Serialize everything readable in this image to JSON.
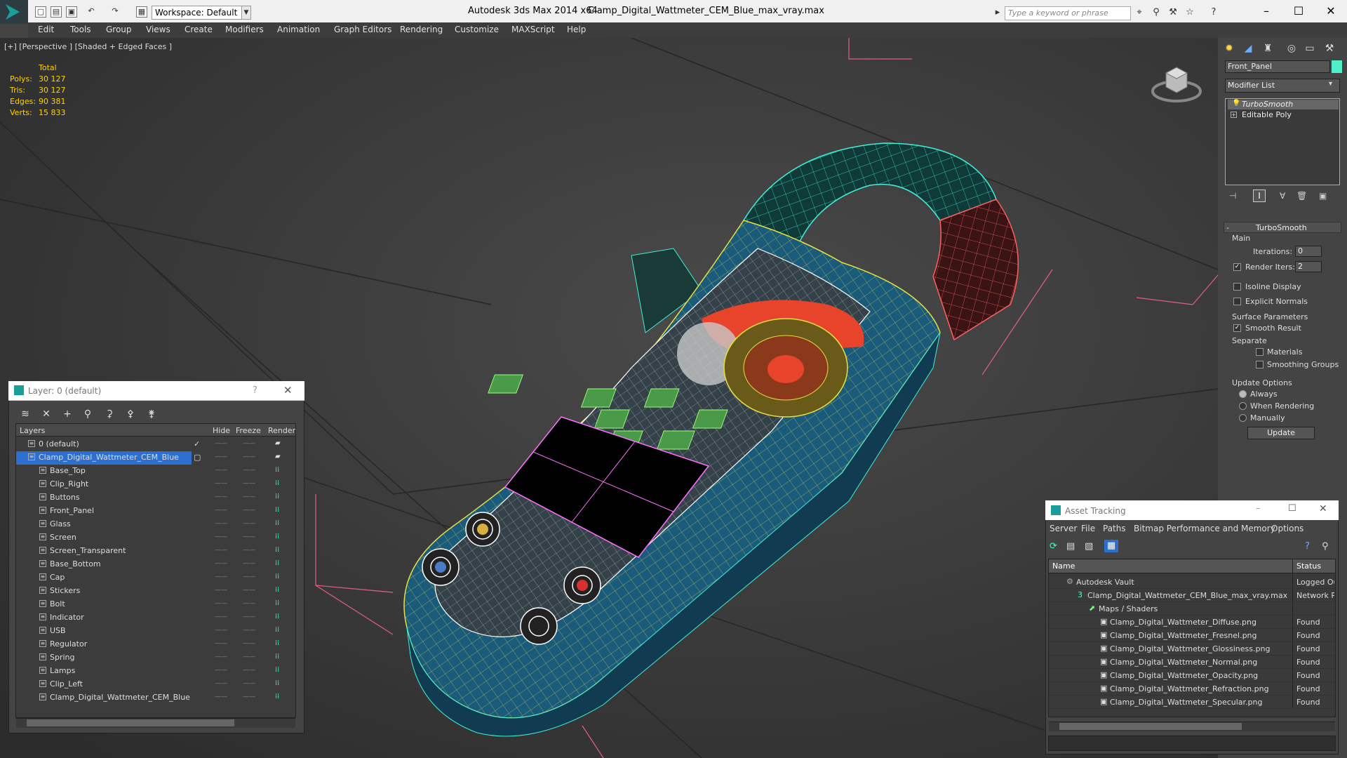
{
  "titlebar": {
    "workspace": "Workspace: Default",
    "app_title": "Autodesk 3ds Max  2014 x64",
    "file_title": "Clamp_Digital_Wattmeter_CEM_Blue_max_vray.max",
    "search_placeholder": "Type a keyword or phrase",
    "minimize": "–",
    "maximize": "☐",
    "close": "✕"
  },
  "menu": [
    "Edit",
    "Tools",
    "Group",
    "Views",
    "Create",
    "Modifiers",
    "Animation",
    "Graph Editors",
    "Rendering",
    "Customize",
    "MAXScript",
    "Help"
  ],
  "viewport": {
    "label": "[+] [Perspective ] [Shaded + Edged Faces ]",
    "stats": {
      "header": "Total",
      "rows": [
        {
          "label": "Polys:",
          "value": "30 127"
        },
        {
          "label": "Tris:",
          "value": "30 127"
        },
        {
          "label": "Edges:",
          "value": "90 381"
        },
        {
          "label": "Verts:",
          "value": "15 833"
        }
      ]
    }
  },
  "layer_dialog": {
    "title": "Layer: 0 (default)",
    "help": "?",
    "close": "✕",
    "headers": {
      "layers": "Layers",
      "hide": "Hide",
      "freeze": "Freeze",
      "render": "Render"
    },
    "layers": [
      {
        "name": "0 (default)",
        "level": 0
      },
      {
        "name": "Clamp_Digital_Wattmeter_CEM_Blue",
        "level": 0,
        "selected": true
      },
      {
        "name": "Base_Top",
        "level": 1
      },
      {
        "name": "Clip_Right",
        "level": 1
      },
      {
        "name": "Buttons",
        "level": 1
      },
      {
        "name": "Front_Panel",
        "level": 1
      },
      {
        "name": "Glass",
        "level": 1
      },
      {
        "name": "Screen",
        "level": 1
      },
      {
        "name": "Screen_Transparent",
        "level": 1
      },
      {
        "name": "Base_Bottom",
        "level": 1
      },
      {
        "name": "Cap",
        "level": 1
      },
      {
        "name": "Stickers",
        "level": 1
      },
      {
        "name": "Bolt",
        "level": 1
      },
      {
        "name": "Indicator",
        "level": 1
      },
      {
        "name": "USB",
        "level": 1
      },
      {
        "name": "Regulator",
        "level": 1
      },
      {
        "name": "Spring",
        "level": 1
      },
      {
        "name": "Lamps",
        "level": 1
      },
      {
        "name": "Clip_Left",
        "level": 1
      },
      {
        "name": "Clamp_Digital_Wattmeter_CEM_Blue",
        "level": 1
      }
    ]
  },
  "command_panel": {
    "object_name": "Front_Panel",
    "object_color": "#4ff0c8",
    "modifier_list": "Modifier List",
    "stack": [
      "TurboSmooth",
      "Editable Poly"
    ],
    "turbosmooth": {
      "title": "TurboSmooth",
      "main": "Main",
      "iterations_label": "Iterations:",
      "iterations": "0",
      "render_iters_label": "Render Iters:",
      "render_iters": "2",
      "isoline": "Isoline Display",
      "explicit": "Explicit Normals",
      "surface": "Surface Parameters",
      "smooth_result": "Smooth Result",
      "separate": "Separate",
      "materials": "Materials",
      "smoothing_groups": "Smoothing Groups",
      "update_options": "Update Options",
      "always": "Always",
      "when_rendering": "When Rendering",
      "manually": "Manually",
      "update": "Update"
    }
  },
  "asset_tracking": {
    "title": "Asset Tracking",
    "menu": [
      "Server",
      "File",
      "Paths",
      "Bitmap Performance and Memory",
      "Options"
    ],
    "headers": {
      "name": "Name",
      "status": "Status"
    },
    "rows": [
      {
        "name": "Autodesk Vault",
        "status": "Logged Ou",
        "level": 0
      },
      {
        "name": "Clamp_Digital_Wattmeter_CEM_Blue_max_vray.max",
        "status": "Network Pa",
        "level": 1
      },
      {
        "name": "Maps / Shaders",
        "status": "",
        "level": 2
      },
      {
        "name": "Clamp_Digital_Wattmeter_Diffuse.png",
        "status": "Found",
        "level": 3
      },
      {
        "name": "Clamp_Digital_Wattmeter_Fresnel.png",
        "status": "Found",
        "level": 3
      },
      {
        "name": "Clamp_Digital_Wattmeter_Glossiness.png",
        "status": "Found",
        "level": 3
      },
      {
        "name": "Clamp_Digital_Wattmeter_Normal.png",
        "status": "Found",
        "level": 3
      },
      {
        "name": "Clamp_Digital_Wattmeter_Opacity.png",
        "status": "Found",
        "level": 3
      },
      {
        "name": "Clamp_Digital_Wattmeter_Refraction.png",
        "status": "Found",
        "level": 3
      },
      {
        "name": "Clamp_Digital_Wattmeter_Specular.png",
        "status": "Found",
        "level": 3
      }
    ]
  }
}
